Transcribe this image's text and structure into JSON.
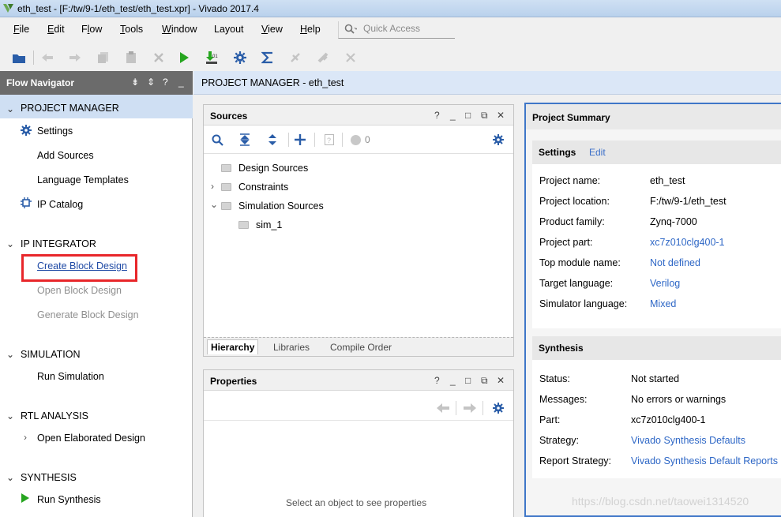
{
  "window": {
    "title": "eth_test - [F:/tw/9-1/eth_test/eth_test.xpr] - Vivado 2017.4"
  },
  "menu": {
    "items": [
      {
        "pre": "",
        "ul": "F",
        "post": "ile"
      },
      {
        "pre": "",
        "ul": "E",
        "post": "dit"
      },
      {
        "pre": "F",
        "ul": "l",
        "post": "ow"
      },
      {
        "pre": "",
        "ul": "T",
        "post": "ools"
      },
      {
        "pre": "",
        "ul": "W",
        "post": "indow"
      },
      {
        "pre": "Layout",
        "ul": "",
        "post": ""
      },
      {
        "pre": "",
        "ul": "V",
        "post": "iew"
      },
      {
        "pre": "",
        "ul": "H",
        "post": "elp"
      }
    ],
    "quick_access_placeholder": "Quick Access"
  },
  "toolbar": {
    "icons": [
      "open-folder-icon",
      "undo-icon",
      "redo-icon",
      "copy-icon",
      "paste-icon",
      "delete-icon",
      "run-icon",
      "program-device-icon",
      "settings-icon",
      "sigma-icon",
      "disabled-tool-1-icon",
      "disabled-tool-2-icon",
      "disabled-tool-3-icon"
    ]
  },
  "flow_navigator": {
    "title": "Flow Navigator",
    "sections": [
      {
        "label": "PROJECT MANAGER",
        "items": [
          "Settings",
          "Add Sources",
          "Language Templates",
          "IP Catalog"
        ]
      },
      {
        "label": "IP INTEGRATOR",
        "items": [
          "Create Block Design",
          "Open Block Design",
          "Generate Block Design"
        ]
      },
      {
        "label": "SIMULATION",
        "items": [
          "Run Simulation"
        ]
      },
      {
        "label": "RTL ANALYSIS",
        "items": [
          "Open Elaborated Design"
        ]
      },
      {
        "label": "SYNTHESIS",
        "items": [
          "Run Synthesis"
        ]
      }
    ]
  },
  "project_manager": {
    "title": "PROJECT MANAGER - eth_test"
  },
  "sources": {
    "title": "Sources",
    "badge_count": "0",
    "tree": [
      "Design Sources",
      "Constraints",
      "Simulation Sources",
      "sim_1"
    ],
    "tabs": [
      "Hierarchy",
      "Libraries",
      "Compile Order"
    ]
  },
  "properties": {
    "title": "Properties",
    "empty_text": "Select an object to see properties"
  },
  "summary": {
    "title": "Project Summary",
    "settings": {
      "label": "Settings",
      "edit": "Edit",
      "rows": [
        {
          "k": "Project name:",
          "v": "eth_test"
        },
        {
          "k": "Project location:",
          "v": "F:/tw/9-1/eth_test"
        },
        {
          "k": "Product family:",
          "v": "Zynq-7000"
        },
        {
          "k": "Project part:",
          "v": "xc7z010clg400-1"
        },
        {
          "k": "Top module name:",
          "v": "Not defined"
        },
        {
          "k": "Target language:",
          "v": "Verilog"
        },
        {
          "k": "Simulator language:",
          "v": "Mixed"
        }
      ]
    },
    "synthesis": {
      "label": "Synthesis",
      "rows": [
        {
          "k": "Status:",
          "v": "Not started"
        },
        {
          "k": "Messages:",
          "v": "No errors or warnings"
        },
        {
          "k": "Part:",
          "v": "xc7z010clg400-1"
        },
        {
          "k": "Strategy:",
          "v": "Vivado Synthesis Defaults"
        },
        {
          "k": "Report Strategy:",
          "v": "Vivado Synthesis Default Reports"
        }
      ]
    }
  },
  "watermark": "https://blog.csdn.net/taowei1314520",
  "colors": {
    "highlight": "#e8262a",
    "link": "#2e67c6",
    "accent": "#3f77c8"
  }
}
